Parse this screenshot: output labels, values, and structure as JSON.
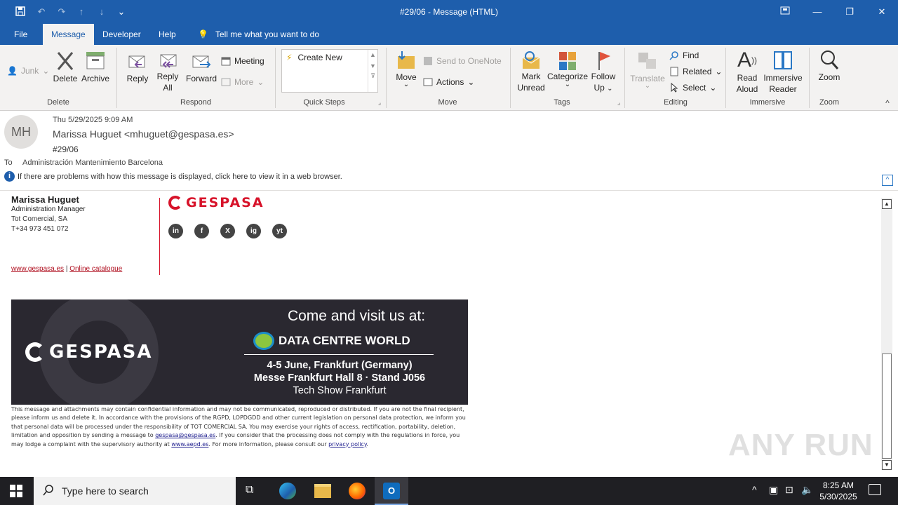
{
  "window": {
    "title": "#29/06  -  Message (HTML)"
  },
  "menu": {
    "items": [
      "File",
      "Message",
      "Developer",
      "Help"
    ],
    "tell_me": "Tell me what you want to do"
  },
  "ribbon": {
    "junk": "Junk",
    "delete": "Delete",
    "archive": "Archive",
    "reply": "Reply",
    "reply_all_1": "Reply",
    "reply_all_2": "All",
    "forward": "Forward",
    "meeting": "Meeting",
    "more": "More",
    "create_new": "Create New",
    "move": "Move",
    "send_onenote": "Send to OneNote",
    "actions": "Actions",
    "mark_1": "Mark",
    "mark_2": "Unread",
    "categorize": "Categorize",
    "follow_1": "Follow",
    "follow_2": "Up",
    "translate": "Translate",
    "find": "Find",
    "related": "Related",
    "select": "Select",
    "read_1": "Read",
    "read_2": "Aloud",
    "immersive_1": "Immersive",
    "immersive_2": "Reader",
    "zoom": "Zoom",
    "groups": {
      "delete": "Delete",
      "respond": "Respond",
      "quick_steps": "Quick Steps",
      "move": "Move",
      "tags": "Tags",
      "editing": "Editing",
      "immersive": "Immersive",
      "zoom": "Zoom"
    }
  },
  "message": {
    "avatar_initials": "MH",
    "date": "Thu 5/29/2025 9:09 AM",
    "sender": "Marissa Huguet <mhuguet@gespasa.es>",
    "subject": "#29/06",
    "to_label": "To",
    "to_value": "Administración Mantenimiento Barcelona",
    "info_bar": "If there are problems with how this message is displayed, click here to view it in a web browser."
  },
  "signature": {
    "name": "Marissa Huguet",
    "role": "Administration Manager",
    "company": "Tot Comercial, SA",
    "phone": "T+34 973 451 072",
    "link_web": "www.gespasa.es",
    "link_sep": " | ",
    "link_catalogue": "Online catalogue",
    "logo_text": "GESPASA",
    "social": [
      "in",
      "f",
      "X",
      "ig",
      "yt"
    ]
  },
  "banner": {
    "logo_text": "GESPASA",
    "headline": "Come and visit us at:",
    "event": "DATA CENTRE WORLD",
    "line1": "4-5 June, Frankfurt (Germany)",
    "line2": "Messe Frankfurt Hall 8 · Stand J056",
    "line3": "Tech Show Frankfurt"
  },
  "legal": {
    "text1": "This message and attachments may contain confidential information and may not be communicated, reproduced or distributed. If you are not the final recipient, please inform us and delete it. In accordance with the provisions of the RGPD, LOPDGDD and other current legislation on personal data protection, we inform you that personal data will be processed under the responsibility of TOT COMERCIAL SA. You may exercise your rights of access, rectification, portability, deletion, limitation and opposition by sending a message to ",
    "email": "gespasa@gespasa.es",
    "text2": ". If you consider that the processing does not comply with the regulations in force, you may lodge a complaint with the supervisory authority at ",
    "aepd": "www.aepd.es",
    "text3": ". For more information, please consult our ",
    "privacy": "privacy policy",
    "text4": "."
  },
  "watermark": "ANY RUN",
  "taskbar": {
    "search_placeholder": "Type here to search",
    "time": "8:25 AM",
    "date": "5/30/2025"
  },
  "colors": {
    "titlebar": "#1e5eac",
    "brand_red": "#d7132a",
    "banner_bg": "#2a2830"
  }
}
